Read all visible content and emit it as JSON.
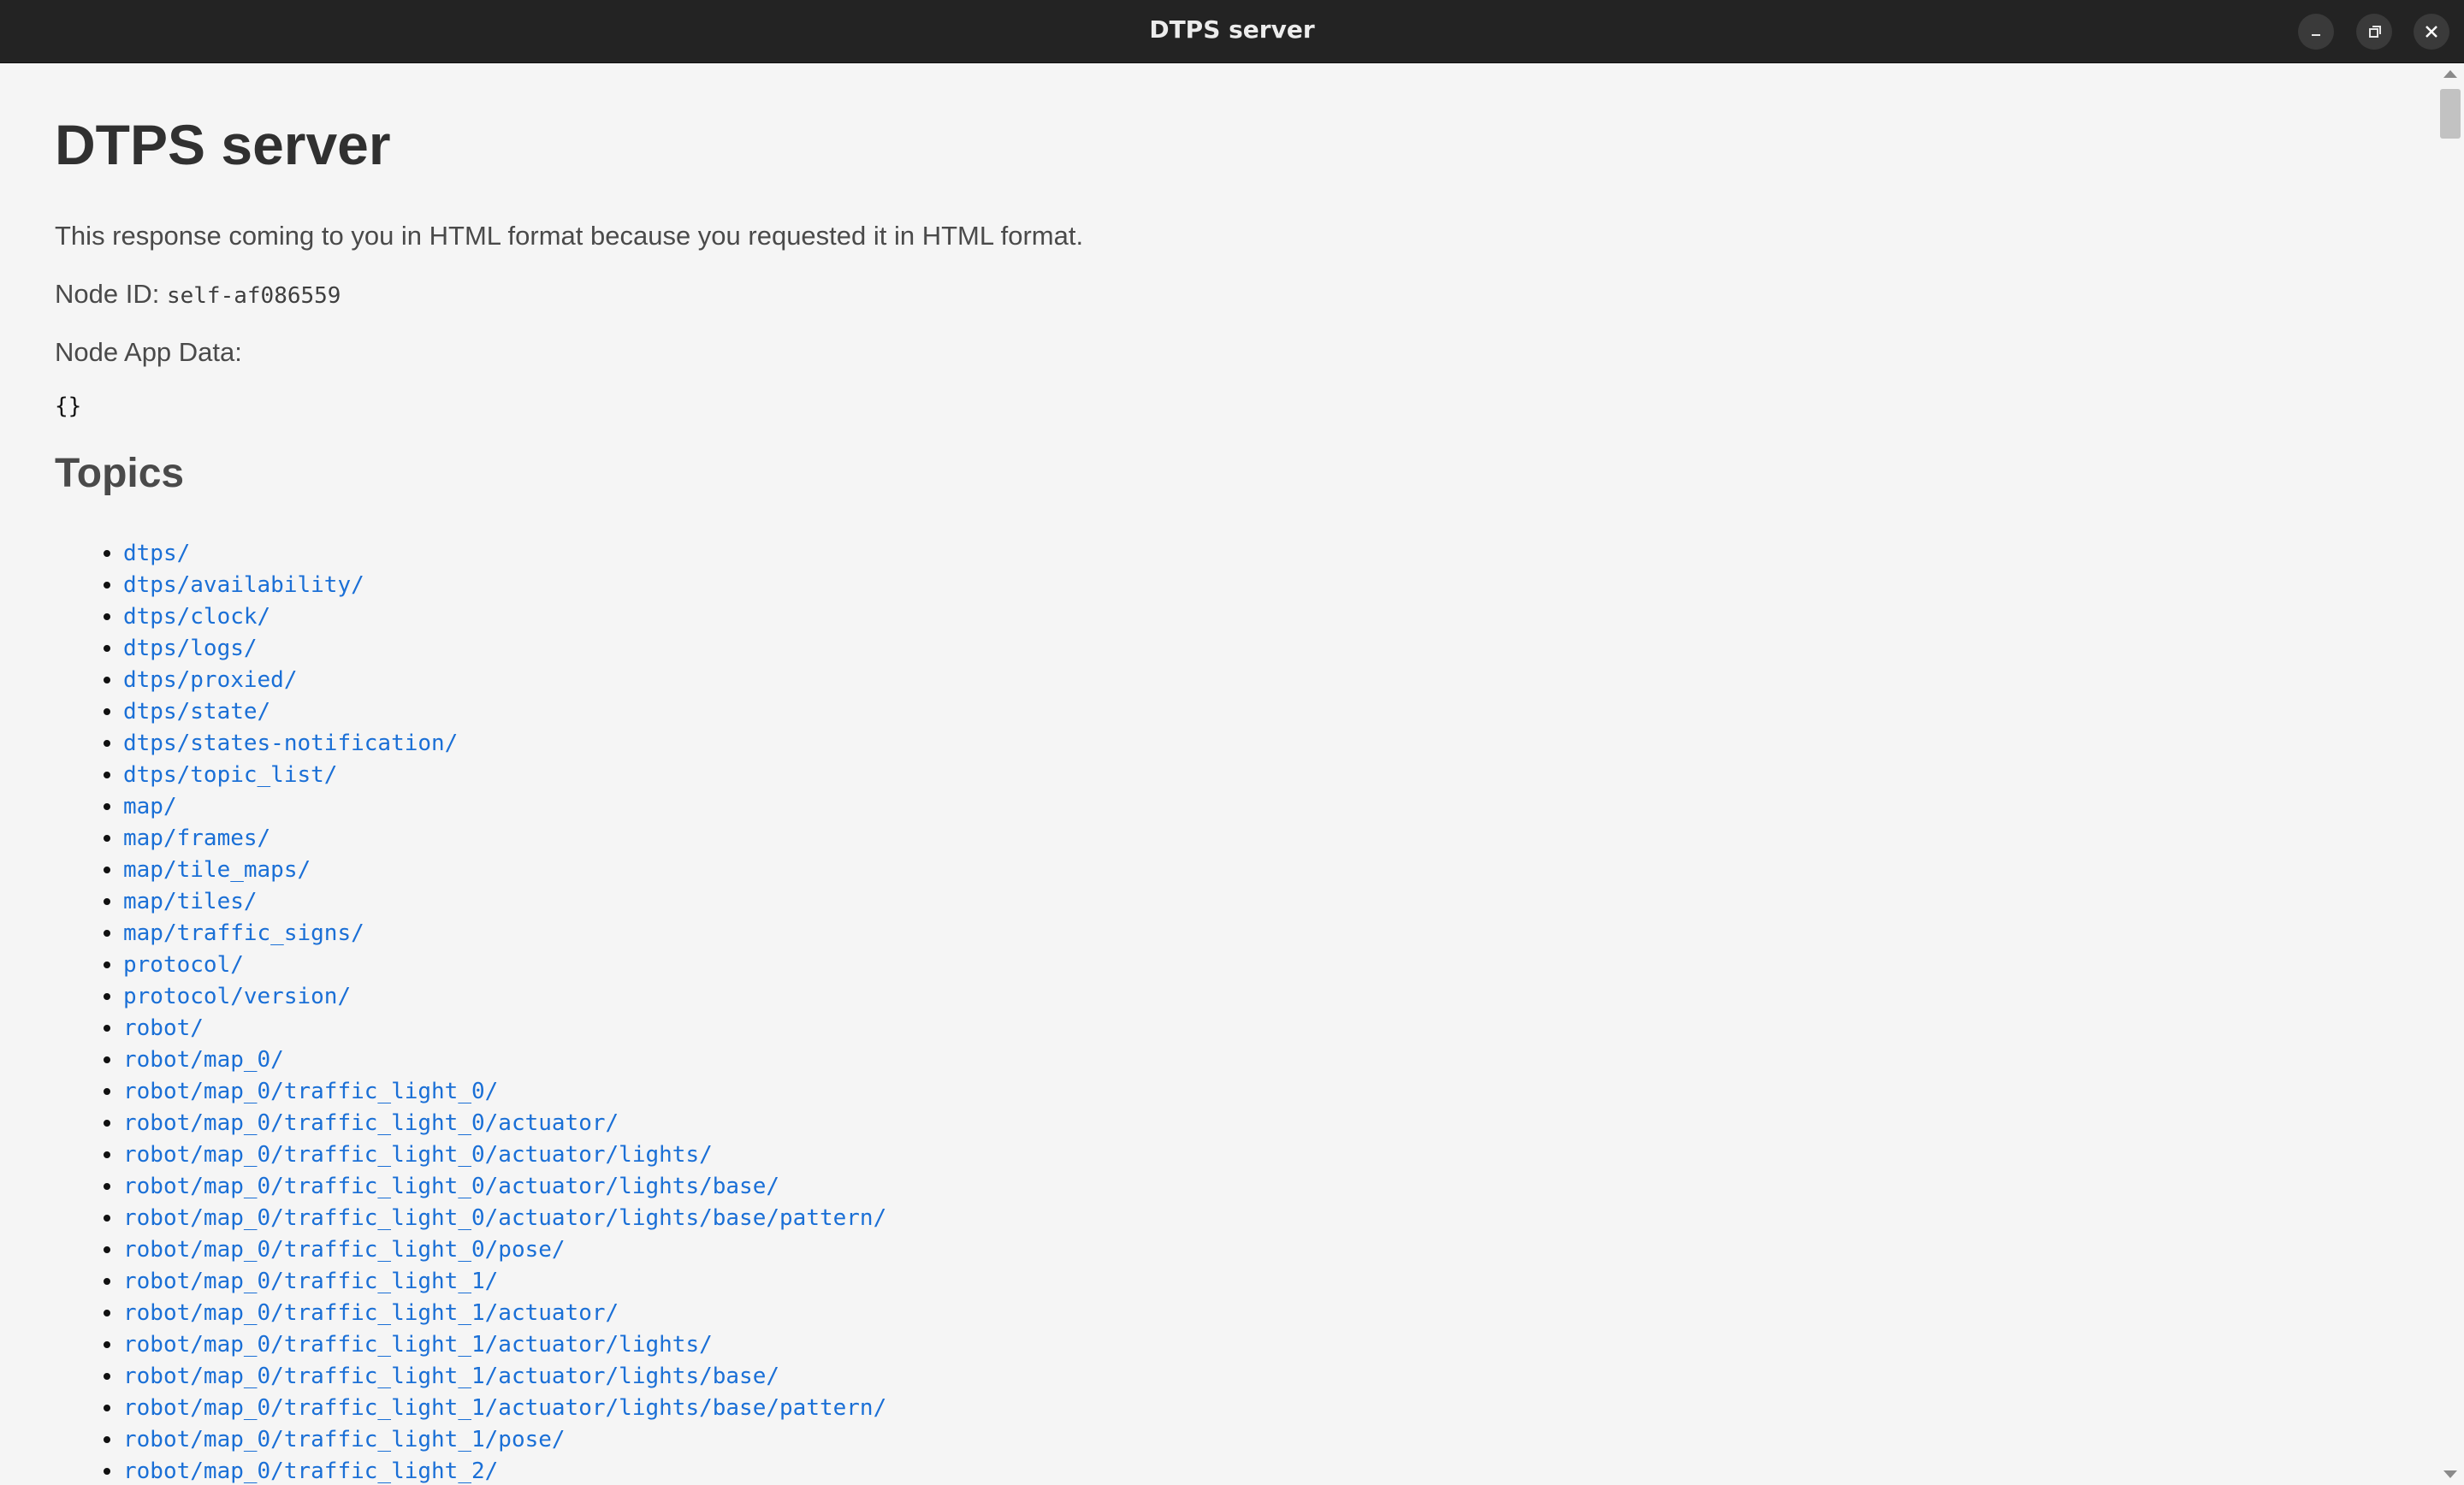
{
  "window": {
    "title": "DTPS server"
  },
  "page": {
    "heading": "DTPS server",
    "intro": "This response coming to you in HTML format because you requested it in HTML format.",
    "node_id_label": "Node ID:",
    "node_id_value": "self-af086559",
    "node_app_data_label": "Node App Data:",
    "node_app_data_value": "{}",
    "topics_heading": "Topics"
  },
  "topics": [
    "dtps/",
    "dtps/availability/",
    "dtps/clock/",
    "dtps/logs/",
    "dtps/proxied/",
    "dtps/state/",
    "dtps/states-notification/",
    "dtps/topic_list/",
    "map/",
    "map/frames/",
    "map/tile_maps/",
    "map/tiles/",
    "map/traffic_signs/",
    "protocol/",
    "protocol/version/",
    "robot/",
    "robot/map_0/",
    "robot/map_0/traffic_light_0/",
    "robot/map_0/traffic_light_0/actuator/",
    "robot/map_0/traffic_light_0/actuator/lights/",
    "robot/map_0/traffic_light_0/actuator/lights/base/",
    "robot/map_0/traffic_light_0/actuator/lights/base/pattern/",
    "robot/map_0/traffic_light_0/pose/",
    "robot/map_0/traffic_light_1/",
    "robot/map_0/traffic_light_1/actuator/",
    "robot/map_0/traffic_light_1/actuator/lights/",
    "robot/map_0/traffic_light_1/actuator/lights/base/",
    "robot/map_0/traffic_light_1/actuator/lights/base/pattern/",
    "robot/map_0/traffic_light_1/pose/",
    "robot/map_0/traffic_light_2/"
  ],
  "icons": {
    "minimize": "minimize-icon",
    "maximize": "restore-icon",
    "close": "close-icon"
  }
}
